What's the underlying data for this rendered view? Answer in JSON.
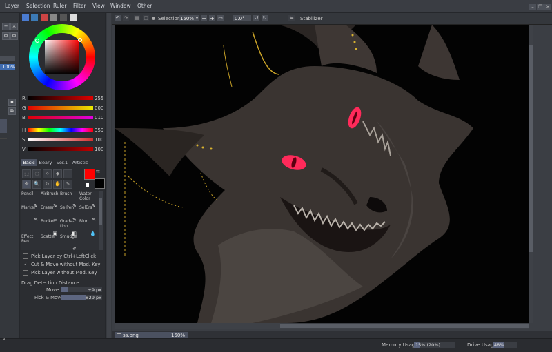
{
  "menu": {
    "items": [
      "Layer",
      "Selection",
      "Ruler",
      "Filter",
      "View",
      "Window",
      "Other"
    ]
  },
  "toolbar": {
    "selection_label": "Selection",
    "zoom_value": "150%",
    "rotation_value": "0.0°",
    "stabilizer_label": "Stabilizer"
  },
  "left_strip": {
    "zoom_value": "100%"
  },
  "color": {
    "sliders": [
      {
        "label": "R",
        "value": "255",
        "fill": "#e00000"
      },
      {
        "label": "G",
        "value": "000",
        "fill": "#e8e800"
      },
      {
        "label": "B",
        "value": "010",
        "fill": "#e000e0"
      },
      {
        "label": "H",
        "value": "359",
        "fill": "rainbow"
      },
      {
        "label": "S",
        "value": "100",
        "fill": "#d23030"
      },
      {
        "label": "V",
        "value": "100",
        "fill": "#c00000"
      }
    ],
    "primary_color": "#ff0000",
    "secondary_color": "#000000"
  },
  "tool_tabs": [
    "Basic",
    "Beary",
    "Ver.1",
    "Artistic"
  ],
  "brushes": [
    {
      "label": "Pencil",
      "glyph": "✎"
    },
    {
      "label": "AirBrush",
      "glyph": "✎"
    },
    {
      "label": "Brush",
      "glyph": "✎"
    },
    {
      "label": "Water Color",
      "glyph": "✎"
    },
    {
      "label": "Marker",
      "glyph": "✎"
    },
    {
      "label": "Eraser",
      "glyph": "▱"
    },
    {
      "label": "SelPen",
      "glyph": "✎"
    },
    {
      "label": "SelErs",
      "glyph": "✎"
    },
    {
      "label": "",
      "glyph": ""
    },
    {
      "label": "Bucket",
      "glyph": "▣"
    },
    {
      "label": "Grada-tion",
      "glyph": "◧"
    },
    {
      "label": "Blur",
      "glyph": "💧"
    },
    {
      "label": "Effect Pen",
      "glyph": ""
    },
    {
      "label": "Scatter",
      "glyph": ""
    },
    {
      "label": "Smudge",
      "glyph": "✐"
    },
    {
      "label": "",
      "glyph": ""
    }
  ],
  "options": [
    {
      "label": "Pick Layer by Ctrl+LeftClick",
      "checked": false
    },
    {
      "label": "Cut & Move without Mod. Key",
      "checked": true
    },
    {
      "label": "Pick Layer without Mod. Key",
      "checked": false
    }
  ],
  "drag": {
    "title": "Drag Detection Distance:",
    "move_label": "Move",
    "move_value": "±9 px",
    "pick_label": "Pick & Move",
    "pick_value": "±29 px"
  },
  "document_tab": {
    "name": "ss.png",
    "zoom": "150%"
  },
  "status": {
    "memory_label": "Memory Usage",
    "memory_value": "15% (20%)",
    "memory_fraction": 0.15,
    "drive_label": "Drive Usage",
    "drive_value": "48%",
    "drive_fraction": 0.48
  }
}
